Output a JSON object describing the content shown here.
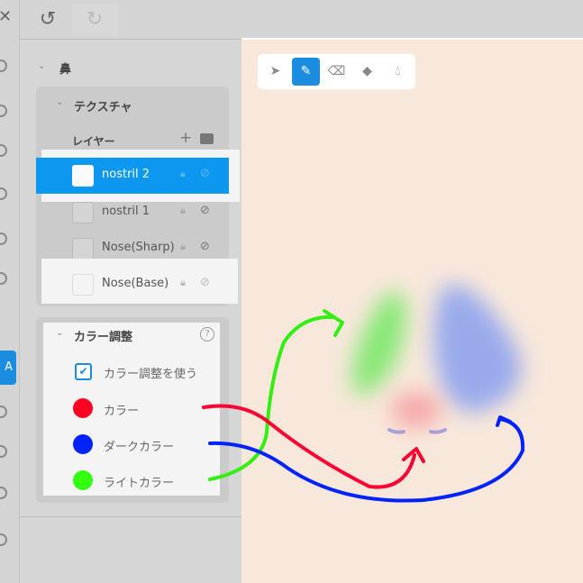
{
  "toolbar": {
    "undo_icon": "undo-icon",
    "redo_icon": "redo-icon",
    "close_icon": "close-icon"
  },
  "section": {
    "title": "鼻"
  },
  "texture": {
    "title": "テクスチャ",
    "layers_label": "レイヤー",
    "layers": [
      {
        "name": "nostril 2",
        "selected": true
      },
      {
        "name": "nostril 1"
      },
      {
        "name": "Nose(Sharp)"
      },
      {
        "name": "Nose(Base)"
      }
    ]
  },
  "color_adjust": {
    "title": "カラー調整",
    "use_label": "カラー調整を使う",
    "use_checked": true,
    "items": [
      {
        "label": "カラー",
        "color": "#ff0022"
      },
      {
        "label": "ダークカラー",
        "color": "#0022ff"
      },
      {
        "label": "ライトカラー",
        "color": "#33ff11"
      }
    ]
  },
  "canvas_tools": [
    "select-tool",
    "pen-tool",
    "eraser-tool",
    "fill-tool",
    "blur-tool"
  ],
  "colors": {
    "accent": "#1a8de0",
    "canvas": "#f8e8db"
  }
}
